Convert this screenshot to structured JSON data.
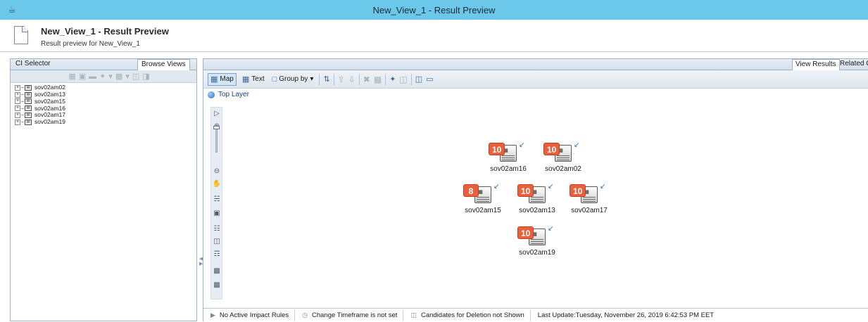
{
  "window": {
    "title": "New_View_1 - Result Preview",
    "app_icon": "java-cup-icon"
  },
  "header": {
    "title": "New_View_1 - Result Preview",
    "subtitle": "Result preview for New_View_1"
  },
  "left_panel": {
    "tabs": [
      {
        "label": "CI Selector",
        "active": false
      },
      {
        "label": "Browse Views",
        "active": true
      }
    ],
    "tree": [
      {
        "label": "sov02am02"
      },
      {
        "label": "sov02am13"
      },
      {
        "label": "sov02am15"
      },
      {
        "label": "sov02am16"
      },
      {
        "label": "sov02am17"
      },
      {
        "label": "sov02am19"
      }
    ]
  },
  "right_panel": {
    "tabs": [
      {
        "label": "View Results",
        "active": true
      },
      {
        "label": "Related C",
        "active": false
      }
    ],
    "toolbar": {
      "map_label": "Map",
      "text_label": "Text",
      "group_by_label": "Group by"
    },
    "layer_label": "Top Layer",
    "nodes": [
      {
        "label": "sov02am16",
        "badge": "10"
      },
      {
        "label": "sov02am02",
        "badge": "10"
      },
      {
        "label": "sov02am15",
        "badge": "8"
      },
      {
        "label": "sov02am13",
        "badge": "10"
      },
      {
        "label": "sov02am17",
        "badge": "10"
      },
      {
        "label": "sov02am19",
        "badge": "10"
      }
    ],
    "status": {
      "impact_rules": "No Active Impact Rules",
      "timeframe": "Change Timeframe is not set",
      "candidates": "Candidates for Deletion not Shown",
      "last_update": "Last Update:Tuesday, November 26, 2019 6:42:53 PM EET"
    }
  },
  "colors": {
    "titlebar": "#6cc8ea",
    "badge": "#e8603c",
    "panel_border": "#9fb3c5"
  }
}
